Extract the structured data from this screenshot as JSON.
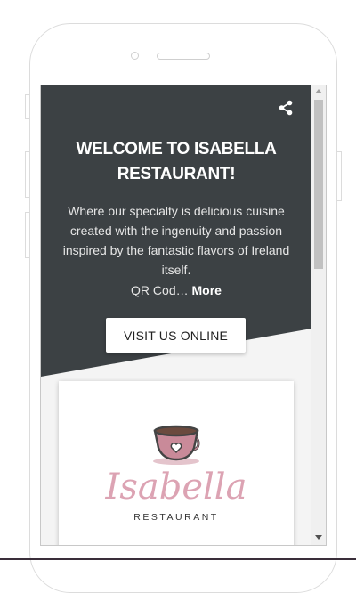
{
  "hero": {
    "share_icon": "share-icon",
    "title": "WELCOME TO ISABELLA RESTAURANT!",
    "description": "Where our specialty is delicious cuisine created with the ingenuity and passion inspired by the fantastic flavors of Ireland itself.",
    "qr_text": "QR Cod…",
    "more_label": "More",
    "background_color": "#3c4144",
    "visit_button_label": "VISIT US ONLINE"
  },
  "logo": {
    "icon": "coffee-cup-heart-icon",
    "script_text": "Isabella",
    "subtitle": "RESTAURANT",
    "accent_color": "#dca3b3"
  }
}
